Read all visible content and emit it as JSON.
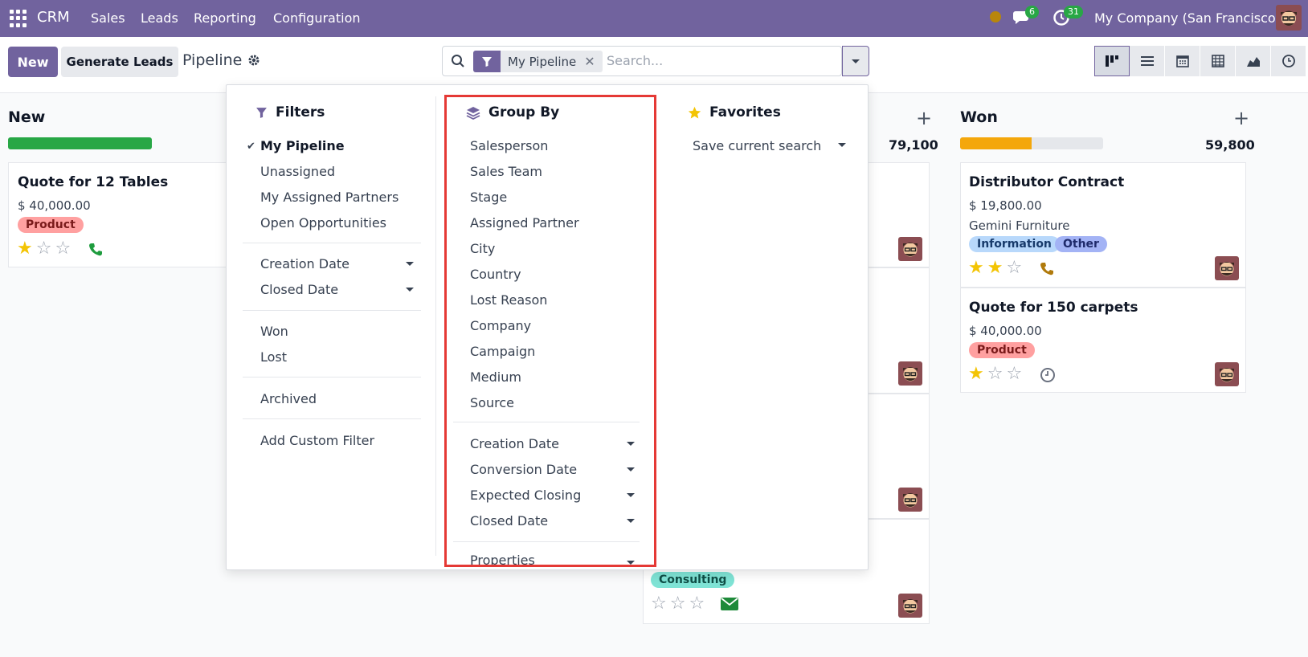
{
  "navbar": {
    "brand": "CRM",
    "menu": [
      "Sales",
      "Leads",
      "Reporting",
      "Configuration"
    ],
    "chat_count": "6",
    "activity_count": "31",
    "company": "My Company (San Francisco)"
  },
  "control": {
    "new_label": "New",
    "generate_label": "Generate Leads",
    "title": "Pipeline",
    "facet_label": "My Pipeline",
    "search_placeholder": "Search..."
  },
  "columns": {
    "new": {
      "title": "New",
      "progress_fraction": 1.0,
      "progress_color": "#28a745",
      "card": {
        "title": "Quote for 12 Tables",
        "amount": "$ 40,000.00",
        "tag": "Product",
        "stars": 1
      }
    },
    "middle": {
      "total": "79,100",
      "tag": "Consulting"
    },
    "won": {
      "title": "Won",
      "total": "59,800",
      "progress_fraction": 0.5,
      "progress_color": "#f4a70b",
      "cards": [
        {
          "title": "Distributor Contract",
          "amount": "$ 19,800.00",
          "partner": "Gemini Furniture",
          "tags": [
            "Information",
            "Other"
          ],
          "stars": 2
        },
        {
          "title": "Quote for 150 carpets",
          "amount": "$ 40,000.00",
          "tag": "Product",
          "stars": 1
        }
      ]
    }
  },
  "dropdown": {
    "filters": {
      "heading": "Filters",
      "items": [
        "My Pipeline",
        "Unassigned",
        "My Assigned Partners",
        "Open Opportunities"
      ],
      "date_items": [
        "Creation Date",
        "Closed Date"
      ],
      "status_items": [
        "Won",
        "Lost"
      ],
      "archived": "Archived",
      "custom": "Add Custom Filter"
    },
    "groupby": {
      "heading": "Group By",
      "items": [
        "Salesperson",
        "Sales Team",
        "Stage",
        "Assigned Partner",
        "City",
        "Country",
        "Lost Reason",
        "Company",
        "Campaign",
        "Medium",
        "Source"
      ],
      "date_items": [
        "Creation Date",
        "Conversion Date",
        "Expected Closing",
        "Closed Date"
      ],
      "properties": "Properties"
    },
    "favorites": {
      "heading": "Favorites",
      "save": "Save current search"
    }
  },
  "colors": {
    "brand": "#71639e",
    "highlight": "#e53935",
    "tag_product": "#ffa0a0",
    "tag_information": "#b8d8fb",
    "tag_other": "#a3b3f5",
    "tag_consulting": "#7fe3d5"
  }
}
